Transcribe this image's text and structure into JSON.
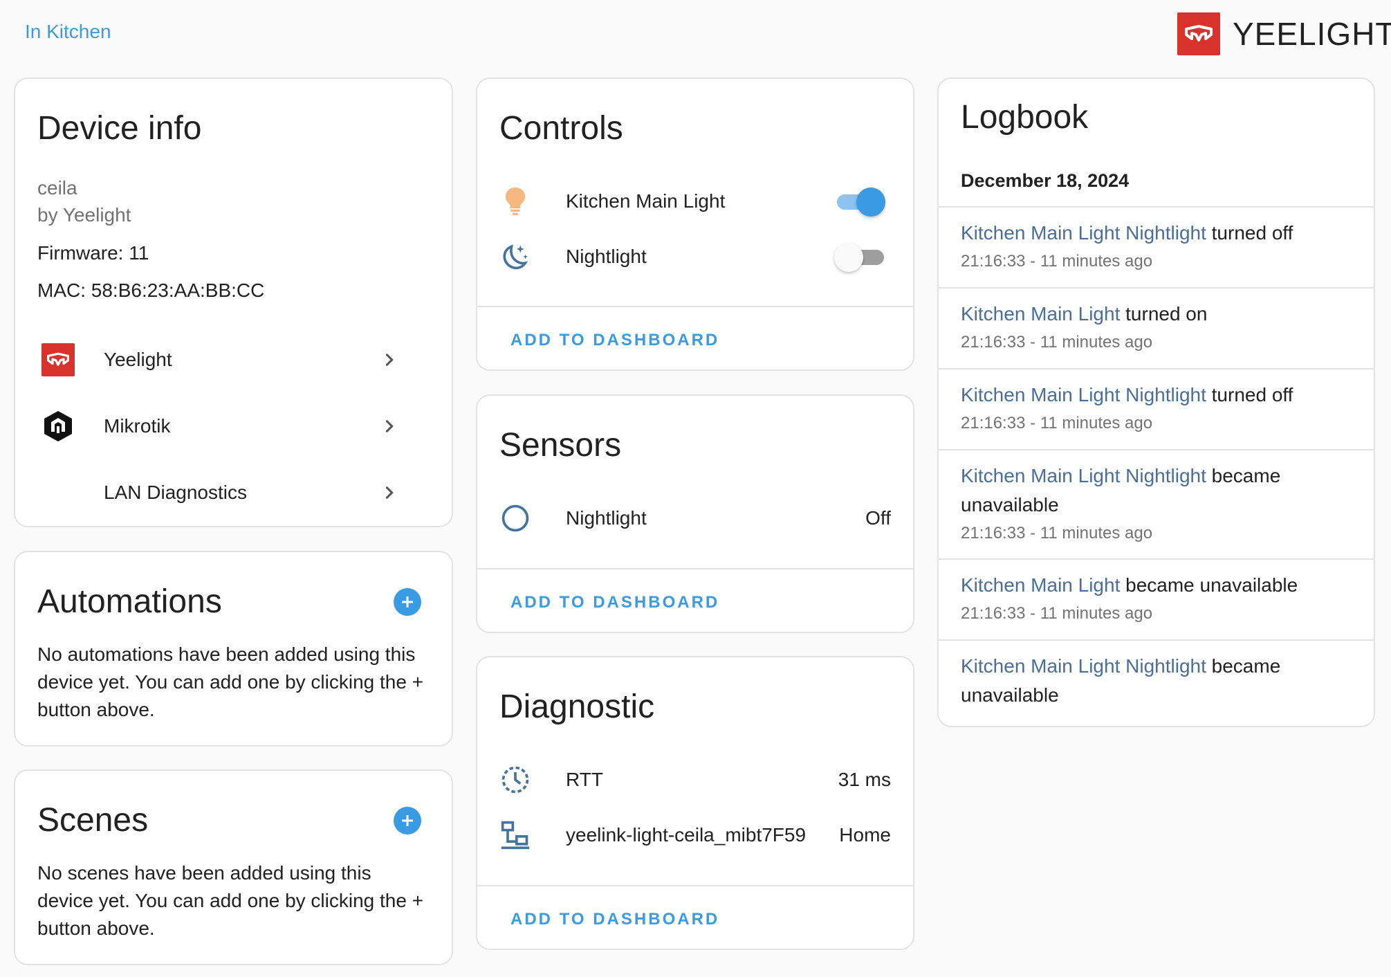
{
  "header": {
    "area_link": "In Kitchen",
    "brand_name": "YEELIGHT",
    "brand_color": "#d8322d"
  },
  "device_info": {
    "title": "Device info",
    "model": "ceila",
    "manufacturer": "by Yeelight",
    "firmware": "Firmware: 11",
    "mac": "MAC: 58:B6:23:AA:BB:CC",
    "integrations": [
      {
        "label": "Yeelight",
        "icon": "yeelight-logo-icon"
      },
      {
        "label": "Mikrotik",
        "icon": "mikrotik-logo-icon"
      },
      {
        "label": "LAN Diagnostics",
        "icon": ""
      }
    ]
  },
  "automations": {
    "title": "Automations",
    "text": "No automations have been added using this device yet. You can add one by clicking the + button above."
  },
  "scenes": {
    "title": "Scenes",
    "text": "No scenes have been added using this device yet. You can add one by clicking the + button above."
  },
  "controls": {
    "title": "Controls",
    "items": [
      {
        "label": "Kitchen Main Light",
        "icon": "lightbulb-icon",
        "state": "on"
      },
      {
        "label": "Nightlight",
        "icon": "moon-stars-icon",
        "state": "off"
      }
    ],
    "add_label": "ADD TO DASHBOARD"
  },
  "sensors": {
    "title": "Sensors",
    "items": [
      {
        "label": "Nightlight",
        "icon": "circle-outline-icon",
        "value": "Off"
      }
    ],
    "add_label": "ADD TO DASHBOARD"
  },
  "diagnostic": {
    "title": "Diagnostic",
    "items": [
      {
        "label": "RTT",
        "icon": "timer-icon",
        "value": "31 ms"
      },
      {
        "label": "yeelink-light-ceila_mibt7F59",
        "icon": "lan-icon",
        "value": "Home"
      }
    ],
    "add_label": "ADD TO DASHBOARD"
  },
  "logbook": {
    "title": "Logbook",
    "date": "December 18, 2024",
    "entries": [
      {
        "name": "Kitchen Main Light Nightlight",
        "action": " turned off",
        "time": "21:16:33 - 11 minutes ago"
      },
      {
        "name": "Kitchen Main Light",
        "action": " turned on",
        "time": "21:16:33 - 11 minutes ago"
      },
      {
        "name": "Kitchen Main Light Nightlight",
        "action": " turned off",
        "time": "21:16:33 - 11 minutes ago"
      },
      {
        "name": "Kitchen Main Light Nightlight",
        "action": " became unavailable",
        "time": "21:16:33 - 11 minutes ago"
      },
      {
        "name": "Kitchen Main Light",
        "action": " became unavailable",
        "time": "21:16:33 - 11 minutes ago"
      },
      {
        "name": "Kitchen Main Light Nightlight",
        "action": " became unavailable",
        "time": ""
      }
    ]
  },
  "colors": {
    "accent": "#3a9be3",
    "entity_link": "#4a6d9a",
    "icon_blue": "#44739e",
    "bulb_on": "#f5b880"
  }
}
